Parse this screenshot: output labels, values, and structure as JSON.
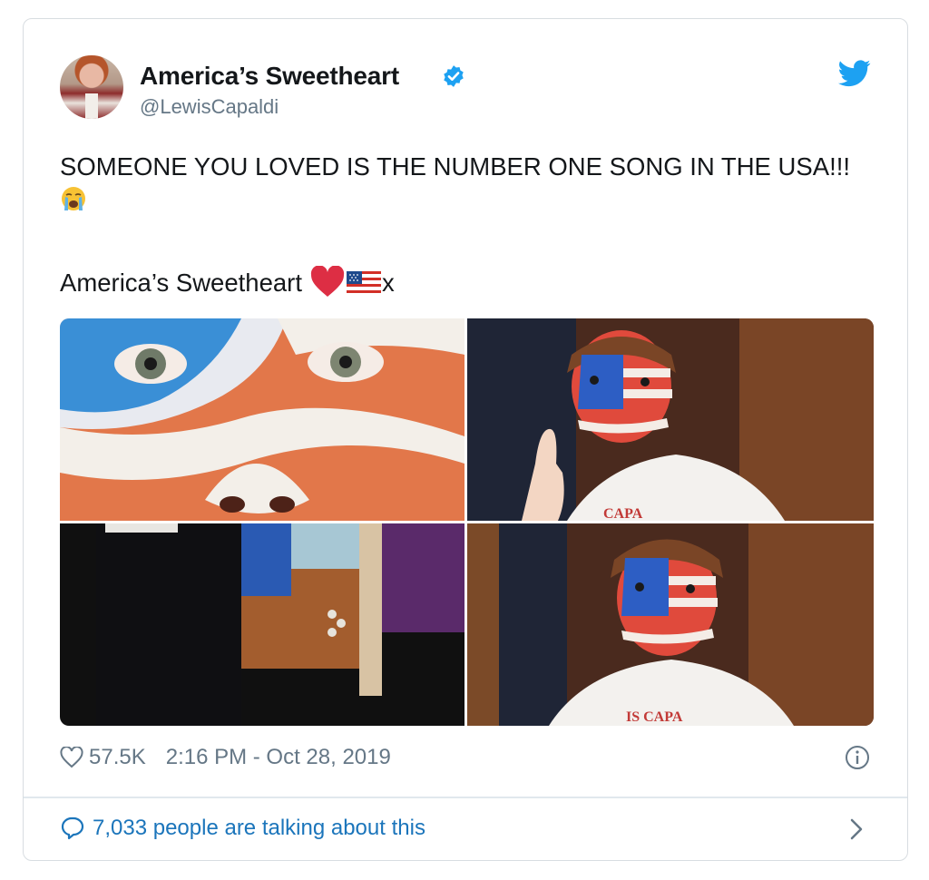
{
  "user": {
    "display_name": "America’s Sweetheart",
    "handle": "@LewisCapaldi",
    "verified": true
  },
  "tweet": {
    "text": "SOMEONE YOU LOVED IS THE NUMBER ONE SONG IN THE USA!!!",
    "second_line": "America’s Sweetheart",
    "second_line_suffix": "x",
    "emojis": [
      "loudly-crying-face",
      "red-heart",
      "us-flag"
    ]
  },
  "media": {
    "count": 4,
    "items": [
      "face-paint-eyes-closeup",
      "finger-up-flag-face",
      "room-interior",
      "flag-face-portrait"
    ],
    "shirt_text": "CAPA",
    "shirt_text_2": "IS CAPA"
  },
  "footer": {
    "likes": "57.5K",
    "timestamp": "2:16 PM - Oct 28, 2019",
    "talking": "7,033 people are talking about this"
  },
  "colors": {
    "accent": "#1da1f2",
    "link": "#1b75bb",
    "muted": "#657786",
    "border": "#d8dde1"
  },
  "icons": [
    "verified-badge-icon",
    "twitter-bird-icon",
    "heart-icon",
    "info-icon",
    "comment-icon",
    "chevron-right-icon"
  ]
}
